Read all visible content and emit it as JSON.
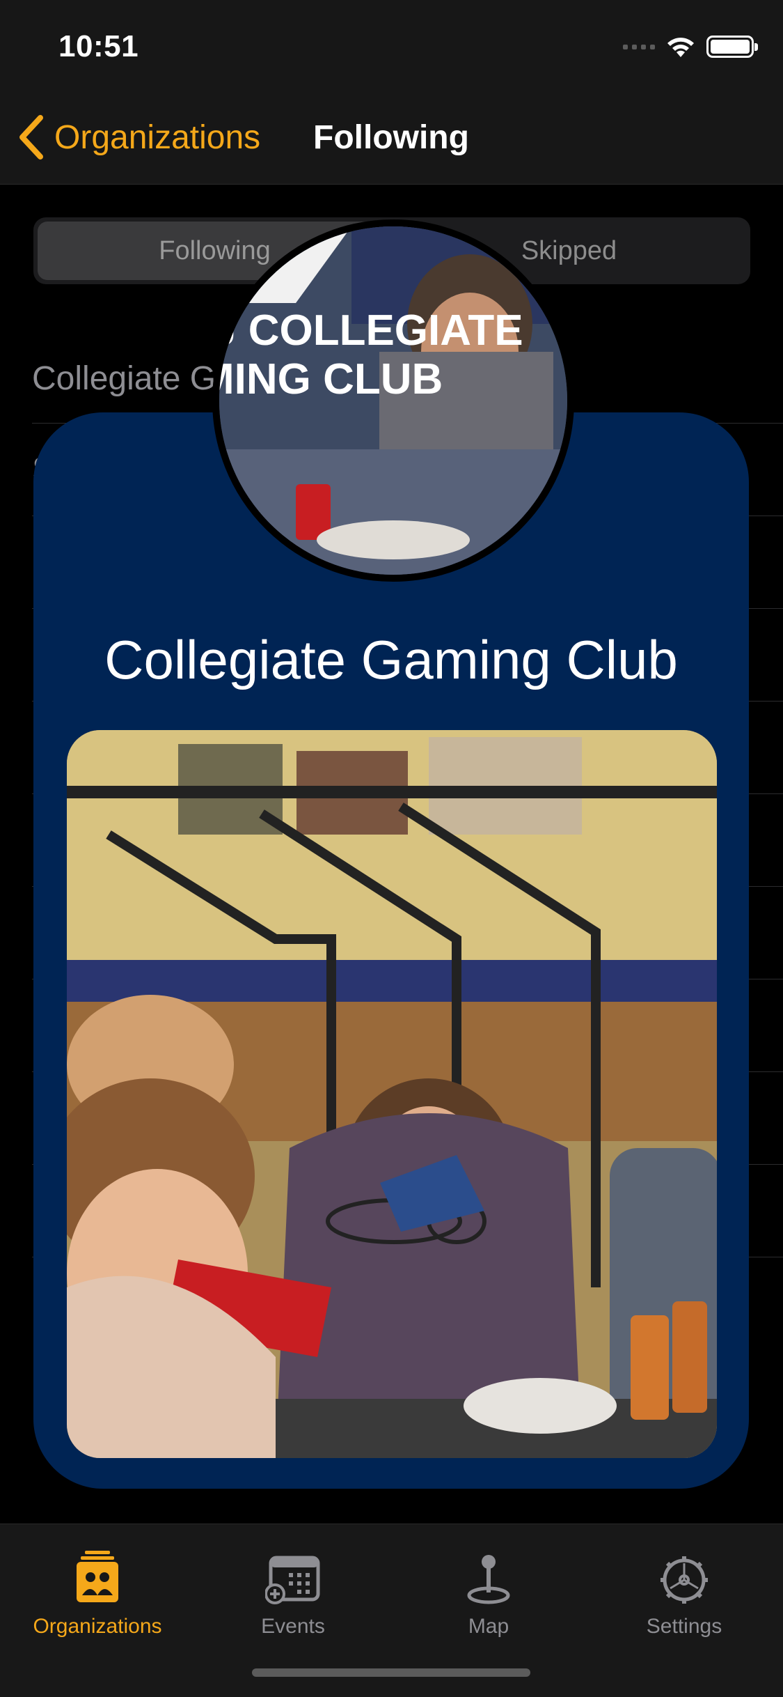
{
  "status_bar": {
    "time": "10:51"
  },
  "nav": {
    "back_label": "Organizations",
    "title": "Following"
  },
  "segmented": {
    "options": [
      "Following",
      "Skipped"
    ],
    "selected": "Following"
  },
  "list": {
    "rows": [
      "Collegiate G",
      "S"
    ]
  },
  "card": {
    "title": "Collegiate Gaming Club",
    "avatar_text_line1": "J COLLEGIATE",
    "avatar_text_line2": "MING CLUB"
  },
  "tabbar": {
    "items": [
      {
        "label": "Organizations",
        "icon": "organizations-icon",
        "active": true
      },
      {
        "label": "Events",
        "icon": "events-icon",
        "active": false
      },
      {
        "label": "Map",
        "icon": "map-pin-icon",
        "active": false
      },
      {
        "label": "Settings",
        "icon": "settings-icon",
        "active": false
      }
    ]
  },
  "colors": {
    "accent": "#f5a81a",
    "card": "#002454",
    "background": "#000000"
  }
}
